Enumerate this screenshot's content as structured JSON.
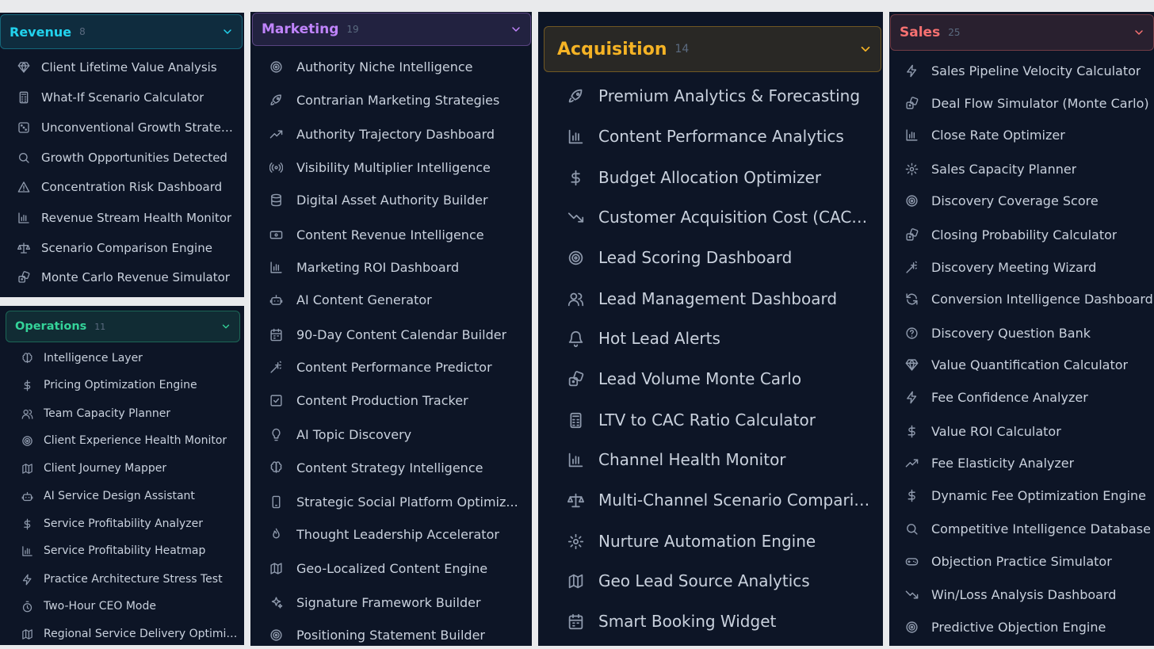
{
  "colors": {
    "page_bg": "#e9eaec",
    "panel_bg": "#0d1526",
    "item_text": "#c9d1dd",
    "icon": "#8f9aad",
    "count": "#5b6b80",
    "revenue": "#22d3ee",
    "operations": "#34d399",
    "marketing": "#c084fc",
    "acquisition": "#f5b325",
    "sales": "#f87171"
  },
  "sections": [
    {
      "id": "revenue",
      "title": "Revenue",
      "count": "8",
      "items": [
        {
          "label": "Client Lifetime Value Analysis",
          "icon": "gem-icon"
        },
        {
          "label": "What-If Scenario Calculator",
          "icon": "calculator-icon"
        },
        {
          "label": "Unconventional Growth Strategies",
          "icon": "dice-icon"
        },
        {
          "label": "Growth Opportunities Detected",
          "icon": "search-icon"
        },
        {
          "label": "Concentration Risk Dashboard",
          "icon": "warning-icon"
        },
        {
          "label": "Revenue Stream Health Monitor",
          "icon": "bar-chart-icon"
        },
        {
          "label": "Scenario Comparison Engine",
          "icon": "scale-icon"
        },
        {
          "label": "Monte Carlo Revenue Simulator",
          "icon": "dice-stack-icon"
        }
      ]
    },
    {
      "id": "operations",
      "title": "Operations",
      "count": "11",
      "items": [
        {
          "label": "Intelligence Layer",
          "icon": "brain-icon"
        },
        {
          "label": "Pricing Optimization Engine",
          "icon": "dollar-icon"
        },
        {
          "label": "Team Capacity Planner",
          "icon": "users-icon"
        },
        {
          "label": "Client Experience Health Monitor",
          "icon": "target-icon"
        },
        {
          "label": "Client Journey Mapper",
          "icon": "map-icon"
        },
        {
          "label": "AI Service Design Assistant",
          "icon": "bot-icon"
        },
        {
          "label": "Service Profitability Analyzer",
          "icon": "dollar-icon"
        },
        {
          "label": "Service Profitability Heatmap",
          "icon": "bar-chart-icon"
        },
        {
          "label": "Practice Architecture Stress Test",
          "icon": "lightning-icon"
        },
        {
          "label": "Two-Hour CEO Mode",
          "icon": "timer-icon"
        },
        {
          "label": "Regional Service Delivery Optimizer",
          "icon": "map-icon"
        }
      ]
    },
    {
      "id": "marketing",
      "title": "Marketing",
      "count": "19",
      "items": [
        {
          "label": "Authority Niche Intelligence",
          "icon": "target-icon"
        },
        {
          "label": "Contrarian Marketing Strategies",
          "icon": "rocket-icon"
        },
        {
          "label": "Authority Trajectory Dashboard",
          "icon": "trending-up-icon"
        },
        {
          "label": "Visibility Multiplier Intelligence",
          "icon": "radio-icon"
        },
        {
          "label": "Digital Asset Authority Builder",
          "icon": "database-icon"
        },
        {
          "label": "Content Revenue Intelligence",
          "icon": "banknote-icon"
        },
        {
          "label": "Marketing ROI Dashboard",
          "icon": "bar-chart-icon"
        },
        {
          "label": "AI Content Generator",
          "icon": "bot-icon"
        },
        {
          "label": "90-Day Content Calendar Builder",
          "icon": "calendar-icon"
        },
        {
          "label": "Content Performance Predictor",
          "icon": "wand-icon"
        },
        {
          "label": "Content Production Tracker",
          "icon": "checkbox-icon"
        },
        {
          "label": "AI Topic Discovery",
          "icon": "lightbulb-icon"
        },
        {
          "label": "Content Strategy Intelligence",
          "icon": "brain-icon"
        },
        {
          "label": "Strategic Social Platform Optimiz...",
          "icon": "smartphone-icon"
        },
        {
          "label": "Thought Leadership Accelerator",
          "icon": "flame-icon"
        },
        {
          "label": "Geo-Localized Content Engine",
          "icon": "map-icon"
        },
        {
          "label": "Signature Framework Builder",
          "icon": "sparkles-icon"
        },
        {
          "label": "Positioning Statement Builder",
          "icon": "target-icon"
        }
      ]
    },
    {
      "id": "acquisition",
      "title": "Acquisition",
      "count": "14",
      "items": [
        {
          "label": "Premium Analytics & Forecasting",
          "icon": "rocket-icon"
        },
        {
          "label": "Content Performance Analytics",
          "icon": "bar-chart-icon"
        },
        {
          "label": "Budget Allocation Optimizer",
          "icon": "dollar-icon"
        },
        {
          "label": "Customer Acquisition Cost (CAC) ...",
          "icon": "trending-down-icon"
        },
        {
          "label": "Lead Scoring Dashboard",
          "icon": "target-icon"
        },
        {
          "label": "Lead Management Dashboard",
          "icon": "users-icon"
        },
        {
          "label": "Hot Lead Alerts",
          "icon": "bell-icon"
        },
        {
          "label": "Lead Volume Monte Carlo",
          "icon": "dice-stack-icon"
        },
        {
          "label": "LTV to CAC Ratio Calculator",
          "icon": "calculator-icon"
        },
        {
          "label": "Channel Health Monitor",
          "icon": "bar-chart-icon"
        },
        {
          "label": "Multi-Channel Scenario Comparis...",
          "icon": "scale-icon"
        },
        {
          "label": "Nurture Automation Engine",
          "icon": "cog-icon"
        },
        {
          "label": "Geo Lead Source Analytics",
          "icon": "map-icon"
        },
        {
          "label": "Smart Booking Widget",
          "icon": "calendar-icon"
        }
      ]
    },
    {
      "id": "sales",
      "title": "Sales",
      "count": "25",
      "items": [
        {
          "label": "Sales Pipeline Velocity Calculator",
          "icon": "lightning-icon"
        },
        {
          "label": "Deal Flow Simulator (Monte Carlo)",
          "icon": "dice-stack-icon"
        },
        {
          "label": "Close Rate Optimizer",
          "icon": "bar-chart-icon"
        },
        {
          "label": "Sales Capacity Planner",
          "icon": "cog-icon"
        },
        {
          "label": "Discovery Coverage Score",
          "icon": "target-icon"
        },
        {
          "label": "Closing Probability Calculator",
          "icon": "dice-stack-icon"
        },
        {
          "label": "Discovery Meeting Wizard",
          "icon": "wand-icon"
        },
        {
          "label": "Conversion Intelligence Dashboard",
          "icon": "refresh-icon"
        },
        {
          "label": "Discovery Question Bank",
          "icon": "help-circle-icon"
        },
        {
          "label": "Value Quantification Calculator",
          "icon": "gem-icon"
        },
        {
          "label": "Fee Confidence Analyzer",
          "icon": "lightning-icon"
        },
        {
          "label": "Value ROI Calculator",
          "icon": "dollar-icon"
        },
        {
          "label": "Fee Elasticity Analyzer",
          "icon": "trending-up-icon"
        },
        {
          "label": "Dynamic Fee Optimization Engine",
          "icon": "dollar-icon"
        },
        {
          "label": "Competitive Intelligence Database",
          "icon": "search-icon"
        },
        {
          "label": "Objection Practice Simulator",
          "icon": "gamepad-icon"
        },
        {
          "label": "Win/Loss Analysis Dashboard",
          "icon": "trending-down-icon"
        },
        {
          "label": "Predictive Objection Engine",
          "icon": "target-icon"
        }
      ]
    }
  ]
}
